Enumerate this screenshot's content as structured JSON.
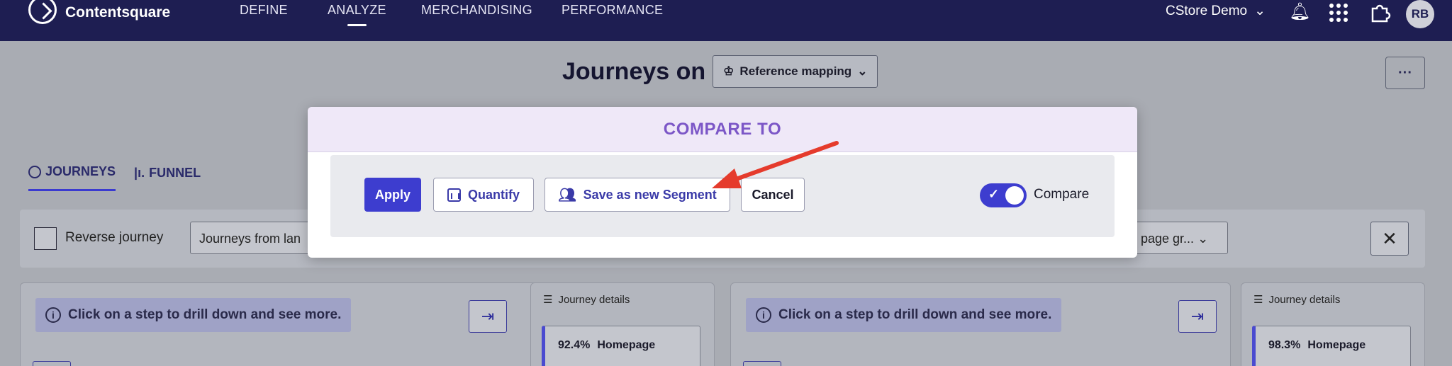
{
  "nav": {
    "brand": "Contentsquare",
    "items": [
      {
        "label": "DEFINE",
        "active": false
      },
      {
        "label": "ANALYZE",
        "active": true
      },
      {
        "label": "MERCHANDISING",
        "active": false
      },
      {
        "label": "PERFORMANCE",
        "active": false
      }
    ],
    "store": "CStore Demo",
    "avatar_initials": "RB"
  },
  "page": {
    "title": "Journeys on",
    "mapping_button": "Reference mapping",
    "more_label": "···"
  },
  "tabs": [
    {
      "label": "JOURNEYS",
      "active": true
    },
    {
      "label": "FUNNEL",
      "active": false
    }
  ],
  "filters": {
    "reverse_label": "Reverse journey",
    "journeys_from": "Journeys from lan",
    "page_group": "page gr..."
  },
  "panels": {
    "info_text": "Click on a step to drill down and see more.",
    "details_title": "Journey details",
    "left_step": {
      "percent": "92.4%",
      "label": "Homepage"
    },
    "right_step": {
      "percent": "98.3%",
      "label": "Homepage"
    }
  },
  "modal": {
    "title": "COMPARE TO",
    "apply_label": "Apply",
    "quantify_label": "Quantify",
    "save_segment_label": "Save as new Segment",
    "cancel_label": "Cancel",
    "compare_label": "Compare",
    "compare_on": true
  },
  "colors": {
    "nav_bg": "#1e1e52",
    "primary": "#3d3dcf",
    "modal_title": "#7c57c7",
    "annotation_arrow": "#e53b2c"
  }
}
